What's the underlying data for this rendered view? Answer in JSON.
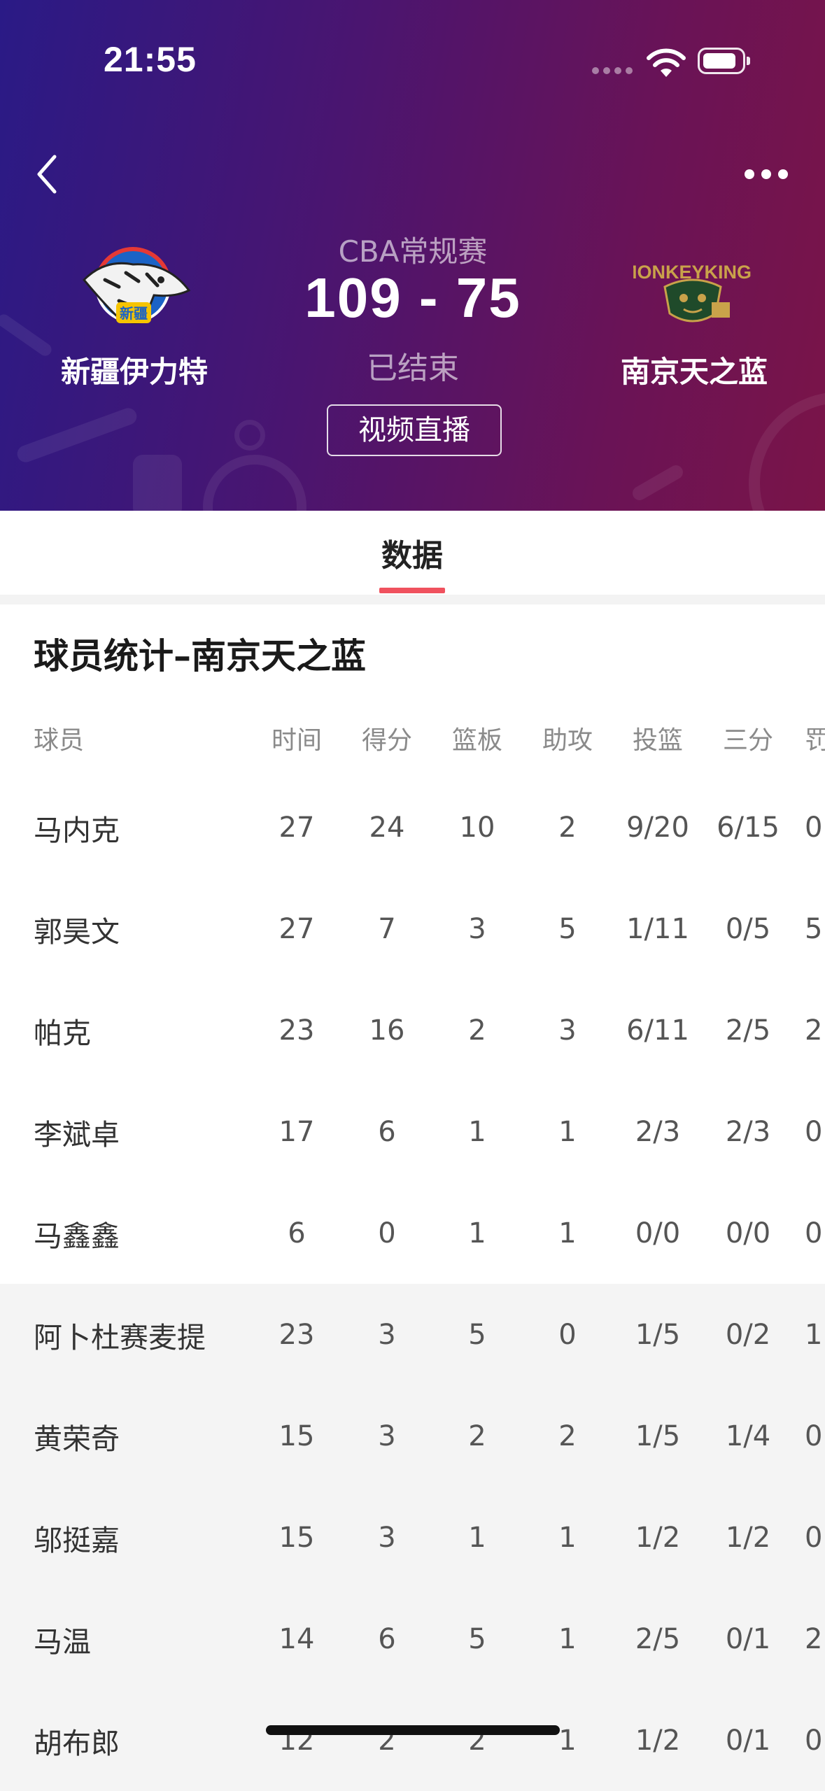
{
  "status_bar": {
    "time": "21:55"
  },
  "match": {
    "league": "CBA常规赛",
    "score": "109  -  75",
    "status": "已结束",
    "video_button": "视频直播",
    "home_team": {
      "name": "新疆伊力特",
      "logo_text": "新疆"
    },
    "away_team": {
      "name": "南京天之蓝",
      "logo_text": "MONKEYKINGS"
    }
  },
  "tabs": {
    "active": "数据"
  },
  "colors": {
    "accent": "#f0515e",
    "header_start": "#2a1a86",
    "header_end": "#7a1448"
  },
  "stats": {
    "title": "球员统计–南京天之蓝",
    "columns": [
      "球员",
      "时间",
      "得分",
      "篮板",
      "助攻",
      "投篮",
      "三分",
      "罚"
    ],
    "starters": [
      {
        "name": "马内克",
        "time": "27",
        "pts": "24",
        "reb": "10",
        "ast": "2",
        "fg": "9/20",
        "three": "6/15",
        "ft": "0"
      },
      {
        "name": "郭昊文",
        "time": "27",
        "pts": "7",
        "reb": "3",
        "ast": "5",
        "fg": "1/11",
        "three": "0/5",
        "ft": "5"
      },
      {
        "name": "帕克",
        "time": "23",
        "pts": "16",
        "reb": "2",
        "ast": "3",
        "fg": "6/11",
        "three": "2/5",
        "ft": "2"
      },
      {
        "name": "李斌卓",
        "time": "17",
        "pts": "6",
        "reb": "1",
        "ast": "1",
        "fg": "2/3",
        "three": "2/3",
        "ft": "0"
      },
      {
        "name": "马鑫鑫",
        "time": "6",
        "pts": "0",
        "reb": "1",
        "ast": "1",
        "fg": "0/0",
        "three": "0/0",
        "ft": "0"
      }
    ],
    "bench": [
      {
        "name": "阿卜杜赛麦提",
        "time": "23",
        "pts": "3",
        "reb": "5",
        "ast": "0",
        "fg": "1/5",
        "three": "0/2",
        "ft": "1"
      },
      {
        "name": "黄荣奇",
        "time": "15",
        "pts": "3",
        "reb": "2",
        "ast": "2",
        "fg": "1/5",
        "three": "1/4",
        "ft": "0"
      },
      {
        "name": "邬挺嘉",
        "time": "15",
        "pts": "3",
        "reb": "1",
        "ast": "1",
        "fg": "1/2",
        "three": "1/2",
        "ft": "0"
      },
      {
        "name": "马温",
        "time": "14",
        "pts": "6",
        "reb": "5",
        "ast": "1",
        "fg": "2/5",
        "three": "0/1",
        "ft": "2"
      },
      {
        "name": "胡布郎",
        "time": "12",
        "pts": "2",
        "reb": "2",
        "ast": "1",
        "fg": "1/2",
        "three": "0/1",
        "ft": "0"
      }
    ]
  }
}
